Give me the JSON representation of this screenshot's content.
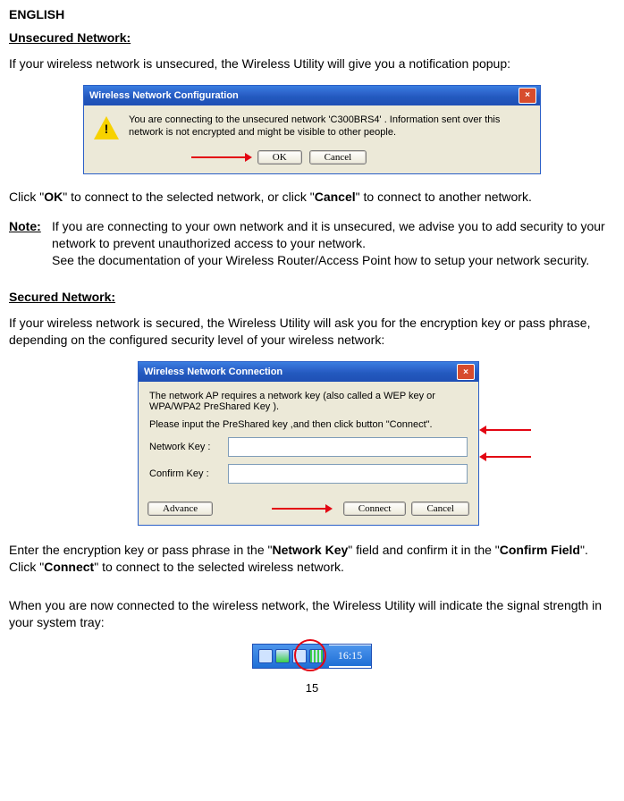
{
  "lang_header": "ENGLISH",
  "unsecured": {
    "title": "Unsecured Network:",
    "intro": "If your wireless network is unsecured, the Wireless Utility will give you a notification popup:",
    "after_dlg_1": "Click \"",
    "after_dlg_ok": "OK",
    "after_dlg_2": "\" to connect to the selected network, or click \"",
    "after_dlg_cancel": "Cancel",
    "after_dlg_3": "\" to connect to another network.",
    "note_label": "Note:",
    "note_body": "If you are connecting to your own network and it is unsecured, we advise you to add security to your network to prevent unauthorized access to your network.\nSee the documentation of your Wireless Router/Access Point how to setup your network security."
  },
  "dlg1": {
    "title": "Wireless Network Configuration",
    "body": "You are connecting to the unsecured network 'C300BRS4' . Information sent over this network is not encrypted and might be visible to other people.",
    "ok": "OK",
    "cancel": "Cancel"
  },
  "secured": {
    "title": "Secured Network:",
    "intro": "If your wireless network is secured, the Wireless Utility will ask you for the encryption key or pass phrase, depending on the configured security level of your wireless network:"
  },
  "dlg2": {
    "title": "Wireless Network Connection",
    "para1": "The network AP requires a network key (also called a WEP key or WPA/WPA2 PreShared Key ).",
    "para2": "Please input the PreShared key ,and then click button \"Connect\".",
    "network_key_label": "Network Key :",
    "confirm_key_label": "Confirm Key :",
    "advance": "Advance",
    "connect": "Connect",
    "cancel": "Cancel"
  },
  "post_dlg2": {
    "p1_a": "Enter the encryption key or pass phrase in the \"",
    "network_key": "Network Key",
    "p1_b": "\" field and confirm it in the \"",
    "confirm_field": "Confirm Field",
    "p1_c": "\". Click \"",
    "connect": "Connect",
    "p1_d": "\" to connect to the selected wireless network."
  },
  "tray_para": "When you are now connected to the wireless network, the Wireless Utility will indicate the signal strength in your system tray:",
  "tray_time": "16:15",
  "page_number": "15"
}
